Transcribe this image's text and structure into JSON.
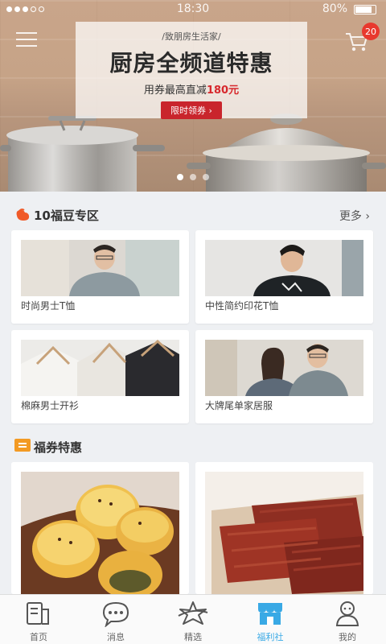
{
  "status_bar": {
    "time": "18:30",
    "battery": "80%"
  },
  "header": {
    "cart_count": "20"
  },
  "banner": {
    "subtitle": "/致朋房生活家/",
    "title": "厨房全频道特惠",
    "desc_prefix": "用券最高直减",
    "desc_amount": "180元",
    "button": "限时领券 ›",
    "slide_index": 1,
    "slide_count": 3
  },
  "section_fudou": {
    "title": "10福豆专区",
    "more": "更多 ›",
    "items": [
      {
        "label": "时尚男士T恤"
      },
      {
        "label": "中性简约印花T恤"
      },
      {
        "label": "棉麻男士开衫"
      },
      {
        "label": "大牌尾单家居服"
      }
    ]
  },
  "section_coupon": {
    "title": "福券特惠"
  },
  "tabbar": {
    "tabs": [
      {
        "label": "首页",
        "icon": "home-icon"
      },
      {
        "label": "消息",
        "icon": "message-icon"
      },
      {
        "label": "精选",
        "icon": "star-icon"
      },
      {
        "label": "福利社",
        "icon": "shop-icon"
      },
      {
        "label": "我的",
        "icon": "profile-icon"
      }
    ],
    "active_tab": "福利社",
    "active_color": "#39a9e5"
  }
}
